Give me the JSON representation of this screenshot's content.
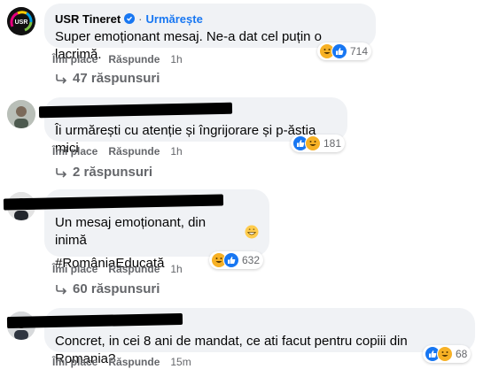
{
  "comments": [
    {
      "author": "USR Tineret",
      "follow_label": "Urmărește",
      "text": "Super emoționant mesaj. Ne-a dat cel puțin o lacrimă.",
      "actions": {
        "like": "Îmi place",
        "reply": "Răspunde",
        "time": "1h"
      },
      "reaction_count": "714",
      "replies_label": "47 răspunsuri"
    },
    {
      "text": "Îi urmărești cu atenție și îngrijorare și p-ăștia mici",
      "actions": {
        "like": "Îmi place",
        "reply": "Răspunde",
        "time": "1h"
      },
      "reaction_count": "181",
      "replies_label": "2 răspunsuri"
    },
    {
      "text": "Un mesaj emoționant, din inimă",
      "hashtag": "#RomâniaEducată",
      "actions": {
        "like": "Îmi place",
        "reply": "Răspunde",
        "time": "1h"
      },
      "reaction_count": "632",
      "replies_label": "60 răspunsuri"
    },
    {
      "text": "Concret, in cei 8 ani de mandat, ce ati facut pentru copiii din Romania?",
      "actions": {
        "like": "Îmi place",
        "reply": "Răspunde",
        "time": "15m"
      },
      "reaction_count": "68"
    }
  ],
  "icons": {
    "reactions": [
      "laugh-reaction-icon",
      "like-reaction-icon"
    ],
    "reply_arrow": "reply-arrow-icon",
    "verified": "verified-badge-icon",
    "emoji": "grinning-emoji-icon"
  },
  "colors": {
    "link": "#1877f2",
    "bubble": "#f0f2f5",
    "meta": "#65676b",
    "laugh": "#f7b125"
  }
}
